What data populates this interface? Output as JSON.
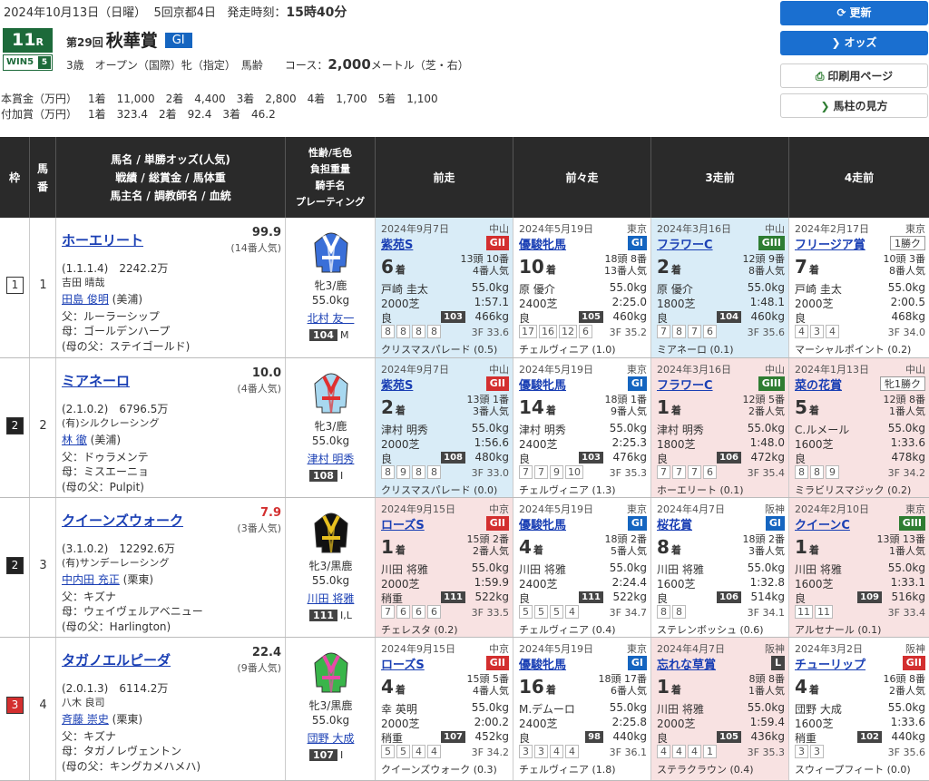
{
  "header": {
    "date": "2024年10月13日（日曜）",
    "kai": "5回京都4日",
    "post_label": "発走時刻：",
    "post_time": "15時40分",
    "race_no": "11",
    "race_r": "R",
    "win5": "WIN5",
    "win5_n": "5",
    "kaiji": "第29回",
    "race_name": "秋華賞",
    "grade": "GI",
    "cond": "3歳　オープン（国際）牝（指定）　馬齢　　コース：",
    "dist": "2,000",
    "dist_unit": "メートル（芝・右）",
    "prize_label": "本賞金（万円）",
    "prize": [
      "1着　11,000",
      "2着　4,400",
      "3着　2,800",
      "4着　1,700",
      "5着　1,100"
    ],
    "add_label": "付加賞（万円）",
    "add": [
      "1着　323.4",
      "2着　92.4",
      "3着　46.2"
    ]
  },
  "buttons": {
    "refresh": "更新",
    "odds": "オッズ",
    "print": "印刷用ページ",
    "guide": "馬柱の見方"
  },
  "th": {
    "waku": "枠",
    "uma": "馬番",
    "horse": [
      "馬名 / 単勝オッズ(人気)",
      "戦績 / 総賞金 / 馬体重",
      "馬主名 / 調教師名 / 血統"
    ],
    "jockey": [
      "性齢/毛色",
      "負担重量",
      "騎手名",
      "プレーティング"
    ],
    "p1": "前走",
    "p2": "前々走",
    "p3": "3走前",
    "p4": "4走前"
  },
  "rows": [
    {
      "waku": "1",
      "uma": "1",
      "name": "ホーエリート",
      "odds": "99.9",
      "pop": "(14番人気)",
      "rec": "(1.1.1.4)　2242.2万",
      "owner": "吉田 晴哉",
      "trainer": "田島 俊明",
      "tloc": "(美浦)",
      "sire": "父：ルーラーシップ",
      "dam": "母：ゴールデンハープ",
      "bms": "(母の父：ステイゴールド)",
      "sex": "牝3/鹿",
      "kg": "55.0kg",
      "jockey": "北村 友一",
      "rating": "104",
      "rmark": "M",
      "past": [
        {
          "bg": "blue",
          "date": "2024年9月7日",
          "venue": "中山",
          "race": "紫苑S",
          "grade": "GII",
          "gc": "g2",
          "pos": "6",
          "heads": "13頭 10番",
          "popl": "4番人気",
          "jockey": "戸崎 圭太",
          "kg": "55.0kg",
          "course": "2000芝",
          "time": "1:57.1",
          "cond": "良",
          "score": "103",
          "bw": "466kg",
          "corners": [
            "8",
            "8",
            "8",
            "8"
          ],
          "f3": "3F 33.6",
          "winner": "クリスマスパレード (0.5)"
        },
        {
          "bg": "",
          "date": "2024年5月19日",
          "venue": "東京",
          "race": "優駿牝馬",
          "grade": "GI",
          "gc": "g1",
          "pos": "10",
          "heads": "18頭 8番",
          "popl": "13番人気",
          "jockey": "原 優介",
          "kg": "55.0kg",
          "course": "2400芝",
          "time": "2:25.0",
          "cond": "良",
          "score": "105",
          "bw": "460kg",
          "corners": [
            "17",
            "16",
            "12",
            "6"
          ],
          "f3": "3F 35.2",
          "winner": "チェルヴィニア (1.0)"
        },
        {
          "bg": "blue",
          "date": "2024年3月16日",
          "venue": "中山",
          "race": "フラワーC",
          "grade": "GIII",
          "gc": "g3",
          "pos": "2",
          "heads": "12頭 9番",
          "popl": "8番人気",
          "jockey": "原 優介",
          "kg": "55.0kg",
          "course": "1800芝",
          "time": "1:48.1",
          "cond": "良",
          "score": "104",
          "bw": "460kg",
          "corners": [
            "7",
            "8",
            "7",
            "6"
          ],
          "f3": "3F 35.6",
          "winner": "ミアネーロ (0.1)"
        },
        {
          "bg": "",
          "date": "2024年2月17日",
          "venue": "東京",
          "race": "フリージア賞",
          "grade": "1勝ク",
          "gc": "cls",
          "pos": "7",
          "heads": "10頭 3番",
          "popl": "8番人気",
          "jockey": "戸崎 圭太",
          "kg": "55.0kg",
          "course": "2000芝",
          "time": "2:00.5",
          "cond": "良",
          "score": "",
          "bw": "468kg",
          "corners": [
            "4",
            "3",
            "4"
          ],
          "f3": "3F 34.0",
          "winner": "マーシャルポイント (0.2)"
        }
      ]
    },
    {
      "waku": "2",
      "uma": "2",
      "name": "ミアネーロ",
      "odds": "10.0",
      "pop": "(4番人気)",
      "rec": "(2.1.0.2)　6796.5万",
      "owner": "(有)シルクレーシング",
      "trainer": "林 徹",
      "tloc": "(美浦)",
      "sire": "父：ドゥラメンテ",
      "dam": "母：ミスエーニョ",
      "bms": "(母の父：Pulpit)",
      "sex": "牝3/鹿",
      "kg": "55.0kg",
      "jockey": "津村 明秀",
      "rating": "108",
      "rmark": "I",
      "past": [
        {
          "bg": "blue",
          "date": "2024年9月7日",
          "venue": "中山",
          "race": "紫苑S",
          "grade": "GII",
          "gc": "g2",
          "pos": "2",
          "heads": "13頭 1番",
          "popl": "3番人気",
          "jockey": "津村 明秀",
          "kg": "55.0kg",
          "course": "2000芝",
          "time": "1:56.6",
          "cond": "良",
          "score": "108",
          "bw": "480kg",
          "corners": [
            "8",
            "9",
            "8",
            "8"
          ],
          "f3": "3F 33.0",
          "winner": "クリスマスパレード (0.0)"
        },
        {
          "bg": "",
          "date": "2024年5月19日",
          "venue": "東京",
          "race": "優駿牝馬",
          "grade": "GI",
          "gc": "g1",
          "pos": "14",
          "heads": "18頭 1番",
          "popl": "9番人気",
          "jockey": "津村 明秀",
          "kg": "55.0kg",
          "course": "2400芝",
          "time": "2:25.3",
          "cond": "良",
          "score": "103",
          "bw": "476kg",
          "corners": [
            "7",
            "7",
            "9",
            "10"
          ],
          "f3": "3F 35.3",
          "winner": "チェルヴィニア (1.3)"
        },
        {
          "bg": "red",
          "date": "2024年3月16日",
          "venue": "中山",
          "race": "フラワーC",
          "grade": "GIII",
          "gc": "g3",
          "pos": "1",
          "heads": "12頭 5番",
          "popl": "2番人気",
          "jockey": "津村 明秀",
          "kg": "55.0kg",
          "course": "1800芝",
          "time": "1:48.0",
          "cond": "良",
          "score": "106",
          "bw": "472kg",
          "corners": [
            "7",
            "7",
            "7",
            "6"
          ],
          "f3": "3F 35.4",
          "winner": "ホーエリート (0.1)"
        },
        {
          "bg": "red",
          "date": "2024年1月13日",
          "venue": "中山",
          "race": "菜の花賞",
          "grade": "牝1勝ク",
          "gc": "cls",
          "pos": "5",
          "heads": "12頭 8番",
          "popl": "1番人気",
          "jockey": "C.ルメール",
          "kg": "55.0kg",
          "course": "1600芝",
          "time": "1:33.6",
          "cond": "良",
          "score": "",
          "bw": "478kg",
          "corners": [
            "8",
            "8",
            "9"
          ],
          "f3": "3F 34.2",
          "winner": "ミラビリスマジック (0.2)"
        }
      ]
    },
    {
      "waku": "2",
      "uma": "3",
      "name": "クイーンズウォーク",
      "odds": "7.9",
      "pop": "(3番人気)",
      "rec": "(3.1.0.2)　12292.6万",
      "owner": "(有)サンデーレーシング",
      "trainer": "中内田 充正",
      "tloc": "(栗東)",
      "sire": "父：キズナ",
      "dam": "母：ウェイヴェルアベニュー",
      "bms": "(母の父：Harlington)",
      "sex": "牝3/黒鹿",
      "kg": "55.0kg",
      "jockey": "川田 将雅",
      "rating": "111",
      "rmark": "I,L",
      "past": [
        {
          "bg": "red",
          "date": "2024年9月15日",
          "venue": "中京",
          "race": "ローズS",
          "grade": "GII",
          "gc": "g2",
          "pos": "1",
          "heads": "15頭 2番",
          "popl": "2番人気",
          "jockey": "川田 将雅",
          "kg": "55.0kg",
          "course": "2000芝",
          "time": "1:59.9",
          "cond": "稍重",
          "score": "111",
          "bw": "522kg",
          "corners": [
            "7",
            "6",
            "6",
            "6"
          ],
          "f3": "3F 33.5",
          "winner": "チェレスタ (0.2)"
        },
        {
          "bg": "",
          "date": "2024年5月19日",
          "venue": "東京",
          "race": "優駿牝馬",
          "grade": "GI",
          "gc": "g1",
          "pos": "4",
          "heads": "18頭 2番",
          "popl": "5番人気",
          "jockey": "川田 将雅",
          "kg": "55.0kg",
          "course": "2400芝",
          "time": "2:24.4",
          "cond": "良",
          "score": "111",
          "bw": "522kg",
          "corners": [
            "5",
            "5",
            "5",
            "4"
          ],
          "f3": "3F 34.7",
          "winner": "チェルヴィニア (0.4)"
        },
        {
          "bg": "",
          "date": "2024年4月7日",
          "venue": "阪神",
          "race": "桜花賞",
          "grade": "GI",
          "gc": "g1",
          "pos": "8",
          "heads": "18頭 2番",
          "popl": "3番人気",
          "jockey": "川田 将雅",
          "kg": "55.0kg",
          "course": "1600芝",
          "time": "1:32.8",
          "cond": "良",
          "score": "106",
          "bw": "514kg",
          "corners": [
            "8",
            "8"
          ],
          "f3": "3F 34.1",
          "winner": "ステレンボッシュ (0.6)"
        },
        {
          "bg": "red",
          "date": "2024年2月10日",
          "venue": "東京",
          "race": "クイーンC",
          "grade": "GIII",
          "gc": "g3",
          "pos": "1",
          "heads": "13頭 13番",
          "popl": "1番人気",
          "jockey": "川田 将雅",
          "kg": "55.0kg",
          "course": "1600芝",
          "time": "1:33.1",
          "cond": "良",
          "score": "109",
          "bw": "516kg",
          "corners": [
            "11",
            "11"
          ],
          "f3": "3F 33.4",
          "winner": "アルセナール (0.1)"
        }
      ]
    },
    {
      "waku": "3",
      "uma": "4",
      "name": "タガノエルピーダ",
      "odds": "22.4",
      "pop": "(9番人気)",
      "rec": "(2.0.1.3)　6114.2万",
      "owner": "八木 良司",
      "trainer": "斉藤 崇史",
      "tloc": "(栗東)",
      "sire": "父：キズナ",
      "dam": "母：タガノレヴェントン",
      "bms": "(母の父：キングカメハメハ)",
      "sex": "牝3/黒鹿",
      "kg": "55.0kg",
      "jockey": "団野 大成",
      "rating": "107",
      "rmark": "I",
      "past": [
        {
          "bg": "",
          "date": "2024年9月15日",
          "venue": "中京",
          "race": "ローズS",
          "grade": "GII",
          "gc": "g2",
          "pos": "4",
          "heads": "15頭 5番",
          "popl": "4番人気",
          "jockey": "幸 英明",
          "kg": "55.0kg",
          "course": "2000芝",
          "time": "2:00.2",
          "cond": "稍重",
          "score": "107",
          "bw": "452kg",
          "corners": [
            "5",
            "5",
            "4",
            "4"
          ],
          "f3": "3F 34.2",
          "winner": "クイーンズウォーク (0.3)"
        },
        {
          "bg": "",
          "date": "2024年5月19日",
          "venue": "東京",
          "race": "優駿牝馬",
          "grade": "GI",
          "gc": "g1",
          "pos": "16",
          "heads": "18頭 17番",
          "popl": "6番人気",
          "jockey": "M.デムーロ",
          "kg": "55.0kg",
          "course": "2400芝",
          "time": "2:25.8",
          "cond": "良",
          "score": "98",
          "bw": "440kg",
          "corners": [
            "3",
            "3",
            "4",
            "4"
          ],
          "f3": "3F 36.1",
          "winner": "チェルヴィニア (1.8)"
        },
        {
          "bg": "red",
          "date": "2024年4月7日",
          "venue": "阪神",
          "race": "忘れな草賞",
          "grade": "L",
          "gc": "gl",
          "pos": "1",
          "heads": "8頭 8番",
          "popl": "1番人気",
          "jockey": "川田 将雅",
          "kg": "55.0kg",
          "course": "2000芝",
          "time": "1:59.4",
          "cond": "良",
          "score": "105",
          "bw": "436kg",
          "corners": [
            "4",
            "4",
            "4",
            "1"
          ],
          "f3": "3F 35.3",
          "winner": "ステラクラウン (0.4)"
        },
        {
          "bg": "",
          "date": "2024年3月2日",
          "venue": "阪神",
          "race": "チューリップ",
          "grade": "GII",
          "gc": "g2",
          "pos": "4",
          "heads": "16頭 8番",
          "popl": "2番人気",
          "jockey": "団野 大成",
          "kg": "55.0kg",
          "course": "1600芝",
          "time": "1:33.6",
          "cond": "稍重",
          "score": "102",
          "bw": "440kg",
          "corners": [
            "3",
            "3"
          ],
          "f3": "3F 35.6",
          "winner": "スウィープフィート (0.0)"
        }
      ]
    }
  ],
  "colors": {
    "waku1": "#ffffff",
    "waku2": "#222222",
    "waku3": "#d32f2f"
  },
  "silks": [
    {
      "body": "#3a6fd8",
      "stripe": "#ffffff"
    },
    {
      "body": "#a8d8f0",
      "stripe": "#e03030"
    },
    {
      "body": "#111111",
      "stripe": "#e8c020"
    },
    {
      "body": "#39b54a",
      "stripe": "#e84aa8"
    }
  ]
}
